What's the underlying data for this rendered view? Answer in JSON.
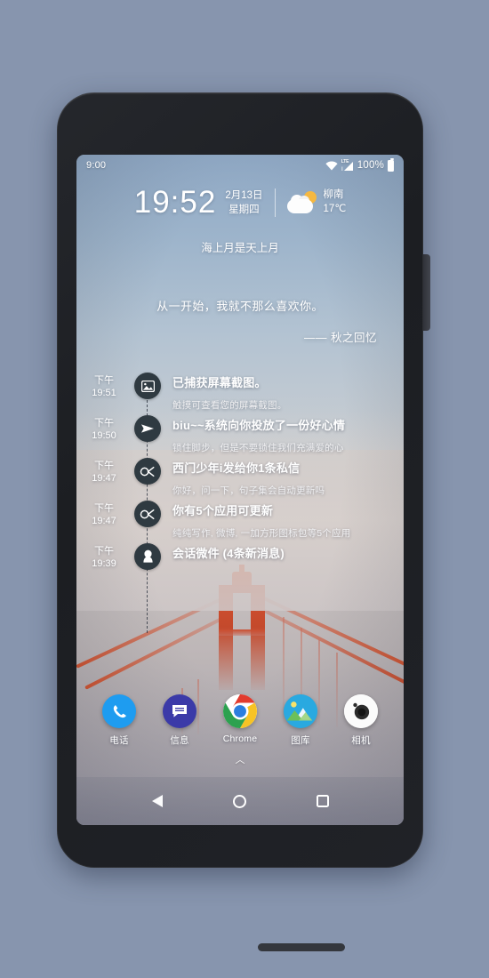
{
  "device": {
    "frame_color": "#202227",
    "screen_bg": "#9aa3b0"
  },
  "status_bar": {
    "time": "9:00",
    "wifi_icon": "wifi-icon",
    "signal_label": "LTE",
    "signal_icon": "cellular-signal-icon",
    "battery_percent": "100%",
    "battery_icon": "battery-full-icon"
  },
  "clock_widget": {
    "time": "19:52",
    "date": "2月13日",
    "weekday": "星期四",
    "weather": {
      "icon": "partly-cloudy-icon",
      "city": "柳南",
      "temperature": "17℃"
    },
    "poem_line": "海上月是天上月"
  },
  "quote": {
    "text": "从一开始，我就不那么喜欢你。",
    "author": "—— 秋之回忆"
  },
  "notifications": [
    {
      "period": "下午",
      "time": "19:51",
      "icon": "screenshot-image-icon",
      "title": "已捕获屏幕截图。",
      "subtitle": "触摸可查看您的屏幕截图。"
    },
    {
      "period": "下午",
      "time": "19:50",
      "icon": "telegram-send-icon",
      "title": "biu~~系统向你投放了一份好心情",
      "subtitle": "锁住脚步，但是不要锁住我们充满爱的心"
    },
    {
      "period": "下午",
      "time": "19:47",
      "icon": "coolapk-icon",
      "title": "西门少年i发给你1条私信",
      "subtitle": "你好，问一下，句子集会自动更新吗"
    },
    {
      "period": "下午",
      "time": "19:47",
      "icon": "coolapk-icon",
      "title": "你有5个应用可更新",
      "subtitle": "纯纯写作, 微博, 一加方形图标包等5个应用"
    },
    {
      "period": "下午",
      "time": "19:39",
      "icon": "qq-penguin-icon",
      "title": "会话微件 (4条新消息)",
      "subtitle": ""
    }
  ],
  "dock": [
    {
      "label": "电话",
      "icon": "phone-icon",
      "color": "#1e9cf0"
    },
    {
      "label": "信息",
      "icon": "messages-icon",
      "color": "#3b3aa8"
    },
    {
      "label": "Chrome",
      "icon": "chrome-icon",
      "color": "#ffffff"
    },
    {
      "label": "图库",
      "icon": "gallery-icon",
      "color": "#29a9e0"
    },
    {
      "label": "相机",
      "icon": "camera-icon",
      "color": "#fbfbfb"
    }
  ],
  "nav_bar": {
    "app_drawer_hint": "︿",
    "back": "back-icon",
    "home": "home-icon",
    "recents": "recents-icon"
  }
}
